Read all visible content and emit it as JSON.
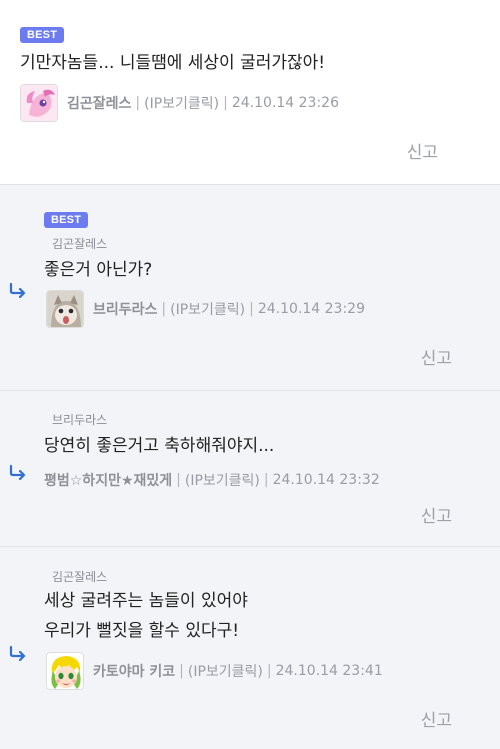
{
  "comments": [
    {
      "badge": "BEST",
      "text_lines": [
        "기만자놈들... 니들땜에 세상이 굴러가잖아!"
      ],
      "nick": "김곤잘레스",
      "ip_note": "(IP보기클릭)",
      "datetime": "24.10.14 23:26",
      "report": "신고",
      "avatar_icon": "pink-pony-avatar-icon"
    },
    {
      "badge": "BEST",
      "parent": "김곤잘레스",
      "text_lines": [
        "좋은거 아닌가?"
      ],
      "nick": "브리두라스",
      "ip_note": "(IP보기클릭)",
      "datetime": "24.10.14 23:29",
      "report": "신고",
      "avatar_icon": "cat-avatar-icon"
    },
    {
      "parent": "브리두라스",
      "text_lines": [
        "당연히 좋은거고 축하해줘야지..."
      ],
      "nick": "평범☆하지만★재밌게",
      "ip_note": "(IP보기클릭)",
      "datetime": "24.10.14 23:32",
      "report": "신고"
    },
    {
      "parent": "김곤잘레스",
      "text_lines": [
        "세상 굴려주는 놈들이 있어야",
        "우리가 뻘짓을 할수 있다구!"
      ],
      "nick": "카토야마 키코",
      "ip_note": "(IP보기클릭)",
      "datetime": "24.10.14 23:41",
      "report": "신고",
      "avatar_icon": "anime-girl-avatar-icon"
    }
  ],
  "colors": {
    "badge": "#6c7cf0",
    "reply_bg": "#f3f4f7",
    "reply_arrow": "#2f6fd6"
  }
}
